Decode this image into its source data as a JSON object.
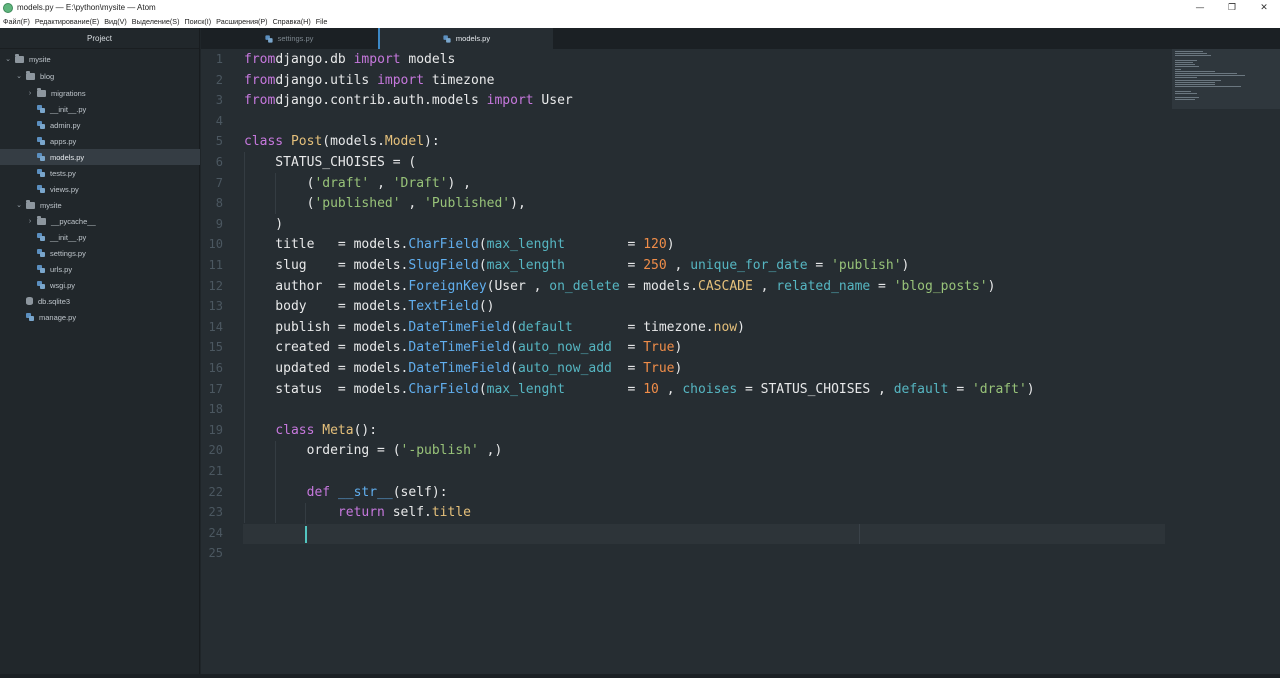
{
  "window": {
    "title": "models.py — E:\\python\\mysite — Atom",
    "controls": [
      "—",
      "❐",
      "✕"
    ]
  },
  "menubar": [
    "Файл(F)",
    "Редактирование(E)",
    "Вид(V)",
    "Выделение(S)",
    "Поиск(I)",
    "Расширения(P)",
    "Справка(H)",
    "File"
  ],
  "tree": {
    "header": "Project",
    "items": [
      {
        "label": "mysite",
        "type": "folder",
        "expanded": true
      },
      {
        "label": "blog",
        "type": "folder",
        "expanded": true
      },
      {
        "label": "migrations",
        "type": "folder",
        "expanded": false
      },
      {
        "label": "__init__.py",
        "type": "py"
      },
      {
        "label": "admin.py",
        "type": "py"
      },
      {
        "label": "apps.py",
        "type": "py"
      },
      {
        "label": "models.py",
        "type": "py",
        "selected": true
      },
      {
        "label": "tests.py",
        "type": "py"
      },
      {
        "label": "views.py",
        "type": "py"
      },
      {
        "label": "mysite",
        "type": "folder",
        "expanded": true
      },
      {
        "label": "__pycache__",
        "type": "folder",
        "expanded": false
      },
      {
        "label": "__init__.py",
        "type": "py"
      },
      {
        "label": "settings.py",
        "type": "py"
      },
      {
        "label": "urls.py",
        "type": "py"
      },
      {
        "label": "wsgi.py",
        "type": "py"
      },
      {
        "label": "db.sqlite3",
        "type": "db"
      },
      {
        "label": "manage.py",
        "type": "py"
      }
    ]
  },
  "tabs": [
    {
      "label": "settings.py",
      "active": false
    },
    {
      "label": "models.py",
      "active": true
    }
  ],
  "editor": {
    "line_numbers": [
      "1",
      "2",
      "3",
      "4",
      "5",
      "6",
      "7",
      "8",
      "9",
      "10",
      "11",
      "12",
      "13",
      "14",
      "15",
      "16",
      "17",
      "18",
      "19",
      "20",
      "21",
      "22",
      "23",
      "24",
      "25"
    ],
    "cursor_line": "24"
  },
  "colors": {
    "keyword": "#c678dd",
    "class": "#e5c07b",
    "string": "#98c379",
    "number": "#f08d49",
    "function": "#61afef",
    "argument": "#56b6c2",
    "background": "#262d32"
  }
}
